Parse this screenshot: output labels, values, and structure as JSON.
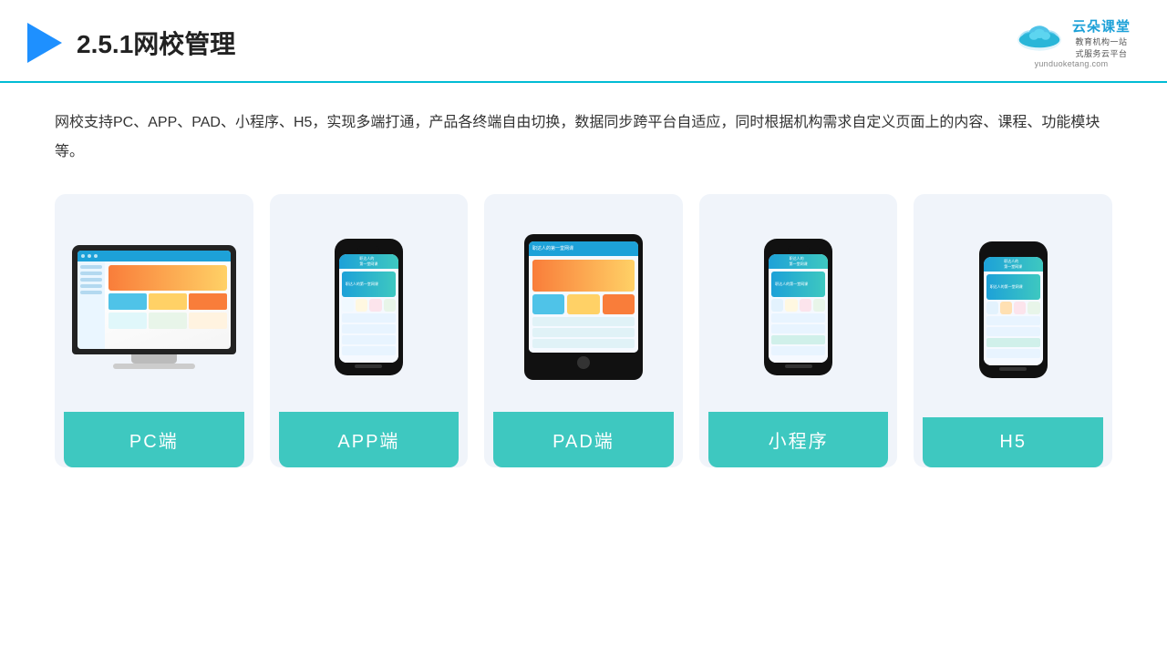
{
  "header": {
    "title": "2.5.1网校管理",
    "logo_brand": "云朵课堂",
    "logo_url": "yunduoketang.com",
    "logo_tagline": "教育机构一站\n式服务云平台"
  },
  "description": "网校支持PC、APP、PAD、小程序、H5，实现多端打通，产品各终端自由切换，数据同步跨平台自适应，同时根据机构需求自定义页面上的内容、课程、功能模块等。",
  "cards": [
    {
      "id": "pc",
      "label": "PC端",
      "device": "pc"
    },
    {
      "id": "app",
      "label": "APP端",
      "device": "phone"
    },
    {
      "id": "pad",
      "label": "PAD端",
      "device": "tablet"
    },
    {
      "id": "miniapp",
      "label": "小程序",
      "device": "phone2"
    },
    {
      "id": "h5",
      "label": "H5",
      "device": "phone3"
    }
  ]
}
